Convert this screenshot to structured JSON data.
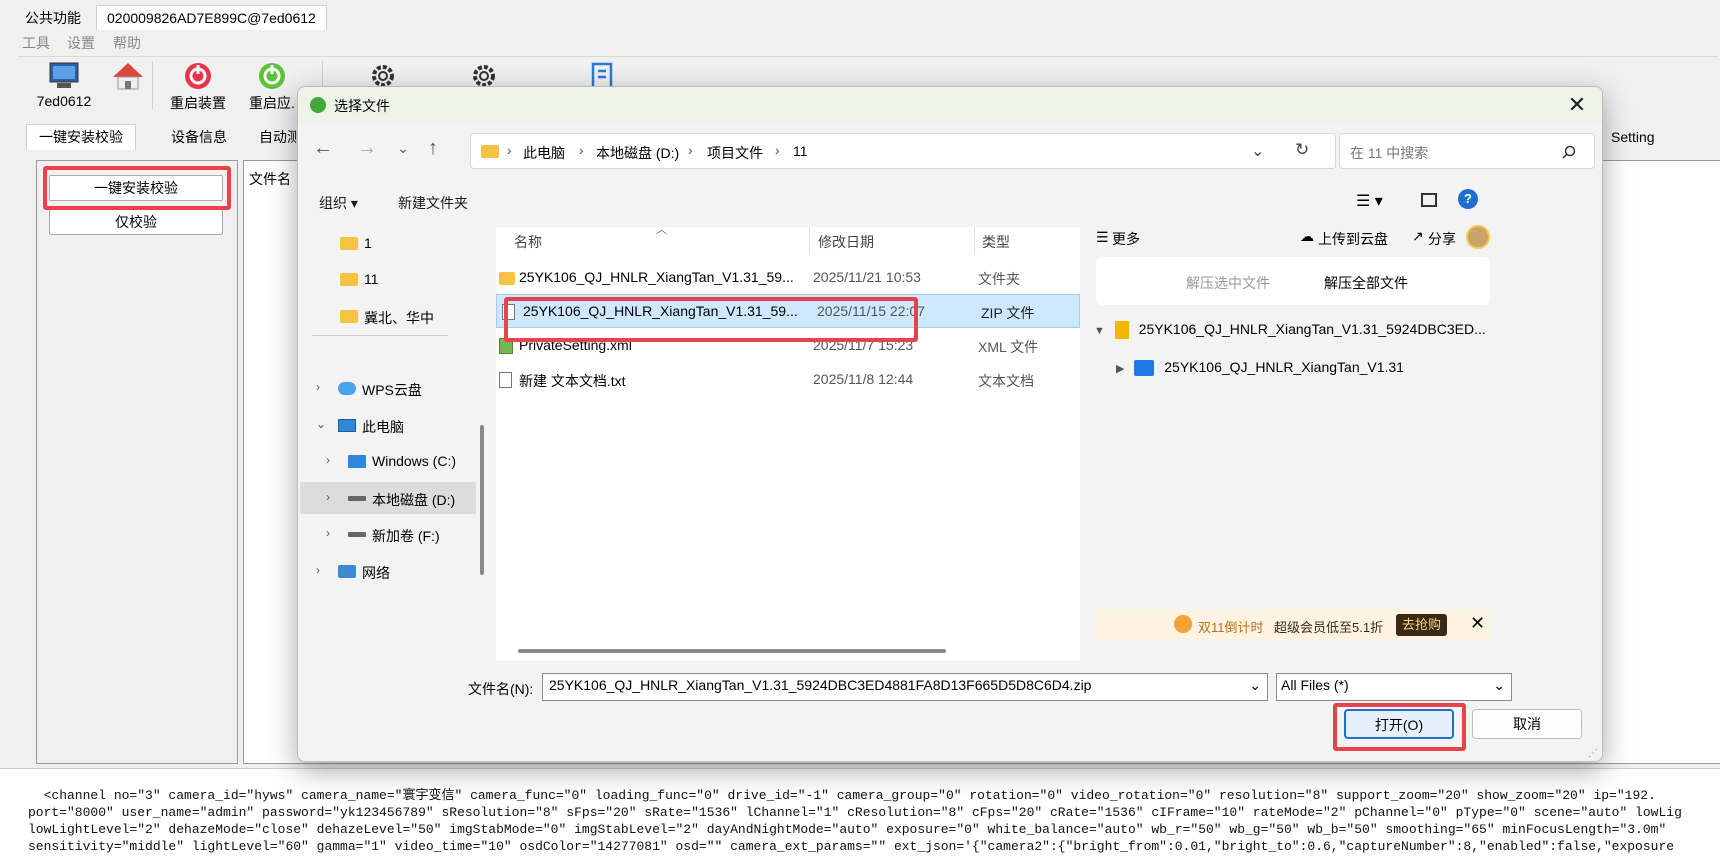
{
  "app": {
    "tabs": [
      "公共功能",
      "020009826AD7E899C@7ed0612"
    ],
    "menu": [
      "工具",
      "设置",
      "帮助"
    ],
    "toolbar": [
      "7ed0612",
      "重启装置",
      "重启应."
    ],
    "sub_tabs": [
      "一键安装校验",
      "设备信息",
      "自动测",
      "Setting"
    ],
    "left_buttons": [
      "一键安装校验",
      "仅校验"
    ],
    "mid_header": "文件名",
    "log_lines": [
      "  <channel no=\"3\" camera_id=\"hyws\" camera_name=\"寰宇变信\" camera_func=\"0\" loading_func=\"0\" drive_id=\"-1\" camera_group=\"0\" rotation=\"0\" video_rotation=\"0\" resolution=\"8\" support_zoom=\"20\" show_zoom=\"20\" ip=\"192.",
      "port=\"8000\" user_name=\"admin\" password=\"yk123456789\" sResolution=\"8\" sFps=\"20\" sRate=\"1536\" lChannel=\"1\" cResolution=\"8\" cFps=\"20\" cRate=\"1536\" cIFrame=\"10\" rateMode=\"2\" pChannel=\"0\" pType=\"0\" scene=\"auto\" lowLig",
      "lowLightLevel=\"2\" dehazeMode=\"close\" dehazeLevel=\"50\" imgStabMode=\"0\" imgStabLevel=\"2\" dayAndNightMode=\"auto\" exposure=\"0\" white_balance=\"auto\" wb_r=\"50\" wb_g=\"50\" wb_b=\"50\" smoothing=\"65\" minFocusLength=\"3.0m\"",
      "sensitivity=\"middle\" lightLevel=\"60\" gamma=\"1\" video_time=\"10\" osdColor=\"14277081\" osd=\"\" camera_ext_params=\"\" ext_json='{\"camera2\":{\"bright_from\":0.01,\"bright_to\":0.6,\"captureNumber\":8,\"enabled\":false,\"exposure"
    ]
  },
  "dialog": {
    "title": "选择文件",
    "breadcrumb": [
      "此电脑",
      "本地磁盘 (D:)",
      "项目文件",
      "11"
    ],
    "search_placeholder": "在 11 中搜索",
    "commands": {
      "organize": "组织 ▾",
      "new_folder": "新建文件夹"
    },
    "tree": [
      {
        "label": "1",
        "icon": "folder-icon"
      },
      {
        "label": "11",
        "icon": "folder-icon"
      },
      {
        "label": "冀北、华中",
        "icon": "folder-icon"
      },
      {
        "label": "WPS云盘",
        "icon": "cloud-icon"
      },
      {
        "label": "此电脑",
        "icon": "computer-icon"
      },
      {
        "label": "Windows (C:)",
        "icon": "drive-icon"
      },
      {
        "label": "本地磁盘 (D:)",
        "icon": "drive-icon"
      },
      {
        "label": "新加卷 (F:)",
        "icon": "drive-icon"
      },
      {
        "label": "网络",
        "icon": "network-icon"
      }
    ],
    "columns": [
      "名称",
      "修改日期",
      "类型"
    ],
    "files": [
      {
        "name": "25YK106_QJ_HNLR_XiangTan_V1.31_59...",
        "date": "2025/11/21 10:53",
        "type": "文件夹",
        "icon": "folder-icon"
      },
      {
        "name": "25YK106_QJ_HNLR_XiangTan_V1.31_59...",
        "date": "2025/11/15 22:07",
        "type": "ZIP 文件",
        "icon": "file-icon"
      },
      {
        "name": "PrivateSetting.xml",
        "date": "2025/11/7 15:23",
        "type": "XML 文件",
        "icon": "xml-icon"
      },
      {
        "name": "新建 文本文档.txt",
        "date": "2025/11/8 12:44",
        "type": "文本文档",
        "icon": "txt-icon"
      }
    ],
    "preview": {
      "more": "更多",
      "upload": "上传到云盘",
      "share": "分享",
      "extract_selected": "解压选中文件",
      "extract_all": "解压全部文件",
      "archive_name": "25YK106_QJ_HNLR_XiangTan_V1.31_5924DBC3ED...",
      "archive_child": "25YK106_QJ_HNLR_XiangTan_V1.31",
      "ad_tag": "双11倒计时",
      "ad_text": "超级会员低至5.1折",
      "ad_button": "去抢购"
    },
    "filename_label": "文件名(N):",
    "filename_value": "25YK106_QJ_HNLR_XiangTan_V1.31_5924DBC3ED4881FA8D13F665D5D8C6D4.zip",
    "filetype": "All Files (*)",
    "open_label": "打开(O)",
    "cancel_label": "取消"
  },
  "colors": {
    "highlight": "#e8434a",
    "selection": "#cde8ff",
    "accent": "#1f6fd0"
  }
}
